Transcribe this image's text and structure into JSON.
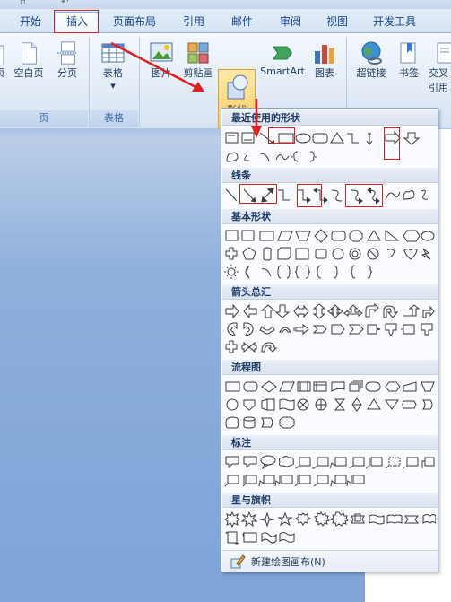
{
  "tabs": [
    {
      "id": "home",
      "label": "开始"
    },
    {
      "id": "insert",
      "label": "插入"
    },
    {
      "id": "layout",
      "label": "页面布局"
    },
    {
      "id": "references",
      "label": "引用"
    },
    {
      "id": "mailings",
      "label": "邮件"
    },
    {
      "id": "review",
      "label": "审阅"
    },
    {
      "id": "view",
      "label": "视图"
    },
    {
      "id": "developer",
      "label": "开发工具"
    }
  ],
  "ribbon": {
    "pages_group": {
      "label": "页",
      "blank_page": "空白页",
      "page_break": "分页",
      "cover_partial": "页"
    },
    "table_group": {
      "label": "表格",
      "table": "表格",
      "dropdown": "▾"
    },
    "illustrations": {
      "picture": "图片",
      "clipart": "剪贴画",
      "shapes": "形状",
      "shapes_arrow": "▾",
      "smartart": "SmartArt",
      "chart": "图表"
    },
    "links": {
      "hyperlink": "超链接",
      "bookmark": "书签",
      "cross_ref_1": "交叉",
      "cross_ref_2": "引用"
    }
  },
  "gallery": {
    "sections": {
      "recent": "最近使用的形状",
      "lines": "线条",
      "basic": "基本形状",
      "arrows": "箭头总汇",
      "flowchart": "流程图",
      "callouts": "标注",
      "stars": "星与旗帜"
    },
    "footer": "新建绘图画布(N)"
  },
  "colors": {
    "accent": "#e02020",
    "ribbon_text": "#15428b",
    "shapes_highlight": "#ffc95c"
  }
}
